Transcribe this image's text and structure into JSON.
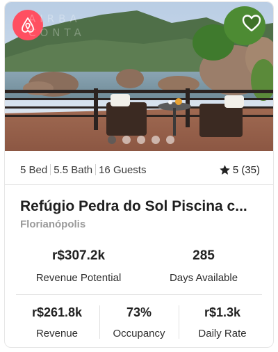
{
  "listing": {
    "photo": {
      "logo": "airbnb-logo-icon",
      "watermark": "AIRBA\nCONTA",
      "favorite_icon": "heart-outline-icon",
      "carousel_dots": 5,
      "active_dot": 1
    },
    "amenities": {
      "beds": "5 Bed",
      "baths": "5.5 Bath",
      "guests": "16 Guests"
    },
    "rating": {
      "icon": "star-icon",
      "text": "5 (35)"
    },
    "title": "Refúgio Pedra do Sol Piscina c...",
    "city": "Florianópolis"
  },
  "metrics_primary": [
    {
      "value": "r$307.2k",
      "label": "Revenue Potential"
    },
    {
      "value": "285",
      "label": "Days Available"
    }
  ],
  "metrics_secondary": [
    {
      "value": "r$261.8k",
      "label": "Revenue"
    },
    {
      "value": "73%",
      "label": "Occupancy"
    },
    {
      "value": "r$1.3k",
      "label": "Daily Rate"
    }
  ],
  "colors": {
    "brand": "#ff4f61",
    "text": "#222222",
    "muted": "#9a9a9a"
  }
}
